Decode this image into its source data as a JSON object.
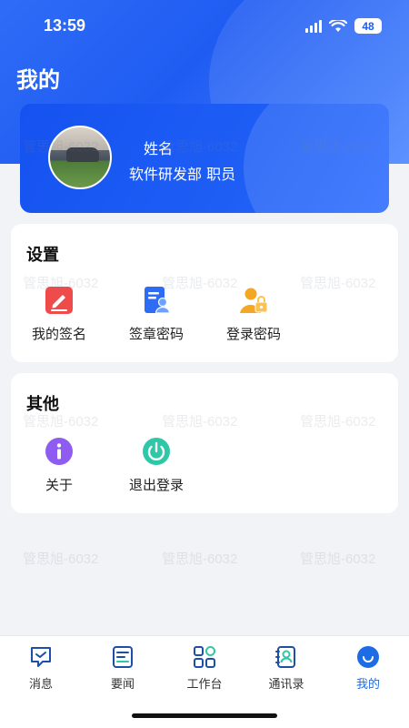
{
  "status_bar": {
    "time": "13:59",
    "battery": "48"
  },
  "page": {
    "title": "我的"
  },
  "profile": {
    "name": "姓名",
    "department": "软件研发部 职员"
  },
  "watermark": "管思旭-6032",
  "settings": {
    "title": "设置",
    "items": [
      {
        "label": "我的签名",
        "icon": "pen-signature-icon",
        "color": "#ef4b4b"
      },
      {
        "label": "签章密码",
        "icon": "document-user-icon",
        "color": "#2f6cf6"
      },
      {
        "label": "登录密码",
        "icon": "user-lock-icon",
        "color": "#f5a623"
      }
    ]
  },
  "other": {
    "title": "其他",
    "items": [
      {
        "label": "关于",
        "icon": "info-icon",
        "color": "#8e5cf0"
      },
      {
        "label": "退出登录",
        "icon": "power-icon",
        "color": "#2ec8a8"
      }
    ]
  },
  "tabbar": {
    "items": [
      {
        "label": "消息",
        "icon": "message-icon"
      },
      {
        "label": "要闻",
        "icon": "news-icon"
      },
      {
        "label": "工作台",
        "icon": "workbench-icon"
      },
      {
        "label": "通讯录",
        "icon": "contacts-icon"
      },
      {
        "label": "我的",
        "icon": "profile-icon",
        "active": true
      }
    ],
    "accent": "#1e6be6"
  }
}
